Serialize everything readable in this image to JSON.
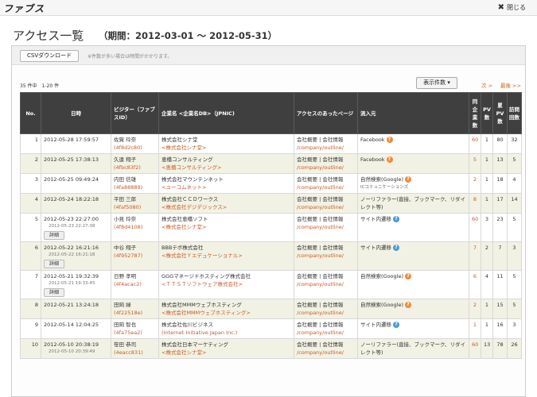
{
  "header": {
    "logo": "ファブス",
    "close_label": "閉じる",
    "close_icon": "✖"
  },
  "page": {
    "title": "アクセス一覧",
    "period": "（期間：2012-03-01 ～ 2012-05-31）"
  },
  "toolbar": {
    "csv_button": "CSVダウンロード",
    "csv_note": "※件数が多い場合は時間がかかります。"
  },
  "list": {
    "count": "35 件中　1-20 件",
    "display_count": "表示件数 ▾",
    "next": "次 >",
    "last": "最後 >>"
  },
  "columns": {
    "no": "No.",
    "date": "日時",
    "visitor": "ビジター（ファブスID）",
    "company": "企業名 <企業名DB>（JPNIC)",
    "page": "アクセスのあったページ",
    "inflow": "流入元",
    "visits": "同企業数",
    "pv": "PV数",
    "cum_pv": "累PV数",
    "times": "訪問回数"
  },
  "rows": [
    {
      "no": "1",
      "date": "2012-05-28 17:59:57",
      "visitor": "佐賀 玲奈",
      "visitor_id": "(4f8d2c80)",
      "company": "株式会社シナ堂",
      "company_db": "<株式会社シナ堂>",
      "page": "会社概要 | 会社情報",
      "page_path": "/company/outline/",
      "inflow": "Facebook",
      "inflow_icon": "orange",
      "visits": "60",
      "pv": "1",
      "cum_pv": "80",
      "times": "32"
    },
    {
      "no": "2",
      "date": "2012-05-25 17:38:13",
      "visitor": "久遠 翔子",
      "visitor_id": "(4fbc83f2)",
      "company": "恵橋コンサルティング",
      "company_db": "<恵橋コンサルティング>",
      "page": "会社概要 | 会社情報",
      "page_path": "/company/outline/",
      "inflow": "Facebook",
      "inflow_icon": "orange",
      "visits": "5",
      "pv": "1",
      "cum_pv": "13",
      "times": "5"
    },
    {
      "no": "3",
      "date": "2012-05-25 09:49:24",
      "visitor": "内田 信雄",
      "visitor_id": "(4fa88889)",
      "company": "株式会社マウンテンネット",
      "company_db": "<ユーコムネット>",
      "page": "会社概要 | 会社情報",
      "page_path": "/company/outline/",
      "inflow": "自然検索(Google)",
      "inflow_sub": "ICコミュニケーションズ",
      "inflow_icon": "orange",
      "visits": "2",
      "pv": "1",
      "cum_pv": "18",
      "times": "4"
    },
    {
      "no": "4",
      "date": "2012-05-24 18:22:18",
      "visitor": "平田 三郎",
      "visitor_id": "(4faf5080)",
      "company": "株式会社ＣＣＤワークス",
      "company_db": "<株式会社デジデジックス>",
      "page": "会社概要 | 会社情報",
      "page_path": "/company/outline/",
      "inflow": "ノーリファラー(直接、ブックマーク、リダイレクト等)",
      "inflow_icon": "",
      "visits": "8",
      "pv": "1",
      "cum_pv": "17",
      "times": "14"
    },
    {
      "no": "5",
      "date": "2012-05-23 22:27:00",
      "date_sub": "2012-05-23 22:27:38",
      "detail": "詳細",
      "visitor": "小見 玲奈",
      "visitor_id": "(4f8d4108)",
      "company": "株式会社恵橋ソフト",
      "company_db": "<株式会社シナ堂>",
      "page": "会社概要 | 会社情報",
      "page_path": "/company/outline/",
      "inflow": "サイト内遷移",
      "inflow_icon": "blue",
      "visits": "60",
      "pv": "3",
      "cum_pv": "23",
      "times": "5"
    },
    {
      "no": "6",
      "date": "2012-05-22 16:21:16",
      "date_sub": "2012-05-22 16:21:18",
      "detail": "詳細",
      "visitor": "中谷 翔子",
      "visitor_id": "(4f952787)",
      "company": "BBBテボ株式会社",
      "company_db": "<株式会社Ｙエデュケーショナル>",
      "page": "会社概要 | 会社情報",
      "page_path": "/company/outline/",
      "inflow": "サイト内遷移",
      "inflow_icon": "blue",
      "visits": "7",
      "pv": "2",
      "cum_pv": "7",
      "times": "3"
    },
    {
      "no": "7",
      "date": "2012-05-21 19:32:39",
      "date_sub": "2012-05-21 19:33:45",
      "detail": "詳細",
      "visitor": "日野 孝明",
      "visitor_id": "(4f4acac2)",
      "company": "GGGマネージドホスティング株式会社",
      "company_db": "<ＴＴＳＴソフトウェア株式会社>",
      "page": "会社概要 | 会社情報",
      "page_path": "/company/outline/",
      "inflow": "自然検索(Google)",
      "inflow_icon": "orange",
      "visits": "6",
      "pv": "4",
      "cum_pv": "11",
      "times": "5"
    },
    {
      "no": "8",
      "date": "2012-05-21 13:24:18",
      "visitor": "田岡 緑",
      "visitor_id": "(4f22518e)",
      "company": "株式会社MMMウェブホスティング",
      "company_db": "<株式会社MMMウェブホスティング>",
      "page": "会社概要 | 会社情報",
      "page_path": "/company/outline/",
      "inflow": "自然検索(Google)",
      "inflow_icon": "orange",
      "visits": "2",
      "pv": "1",
      "cum_pv": "15",
      "times": "5"
    },
    {
      "no": "9",
      "date": "2012-05-14 12:04:25",
      "visitor": "田岡 智也",
      "visitor_id": "(4fa75ea2)",
      "company": "株式会社佐川ビジネス",
      "company_db": "(Internet Initiative Japan Inc.)",
      "page": "会社概要 | 会社情報",
      "page_path": "/company/outline/",
      "inflow": "サイト内遷移",
      "inflow_icon": "blue",
      "visits": "1",
      "pv": "1",
      "cum_pv": "16",
      "times": "3"
    },
    {
      "no": "10",
      "date": "2012-05-10 20:38:19",
      "date_sub": "2012-05-10 20:39:49",
      "visitor": "笹田 恭司",
      "visitor_id": "(4eacc831)",
      "company": "株式会社日本マーケティング",
      "company_db": "<株式会社シナ堂>",
      "page": "会社概要 | 会社情報",
      "page_path": "/company/outline/",
      "inflow": "ノーリファラー(直接、ブックマーク、リダイレクト等)",
      "inflow_icon": "",
      "visits": "60",
      "pv": "13",
      "cum_pv": "78",
      "times": "26"
    }
  ]
}
